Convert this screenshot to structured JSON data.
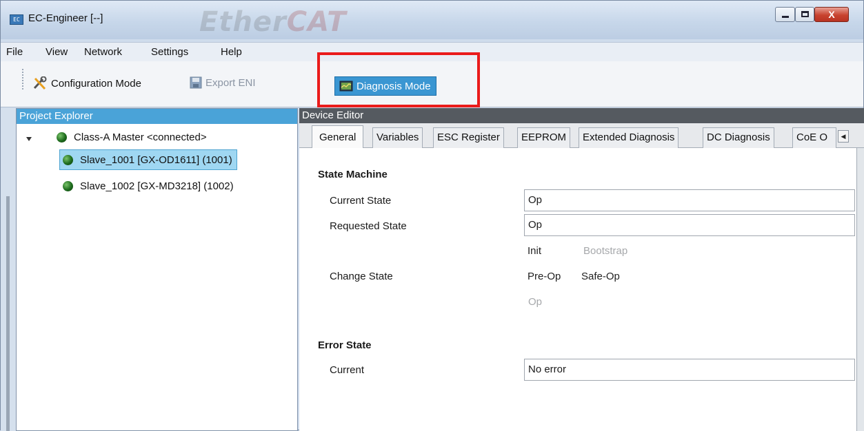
{
  "window": {
    "title": "EC-Engineer [--]",
    "app_icon_text": "EC",
    "brand_logo_prefix": "Ether",
    "brand_logo_suffix": "CAT"
  },
  "window_controls": {
    "minimize": "minimize",
    "maximize": "maximize",
    "close": "X"
  },
  "menu": [
    "File",
    "View",
    "Network",
    "Settings",
    "Help"
  ],
  "toolbar": {
    "configuration_mode": "Configuration Mode",
    "export_eni": "Export ENI",
    "diagnosis_mode": "Diagnosis Mode"
  },
  "project_explorer": {
    "title": "Project Explorer",
    "master": "Class-A Master <connected>",
    "slaves": [
      {
        "label": "Slave_1001 [GX-OD1611] (1001)",
        "selected": true
      },
      {
        "label": "Slave_1002 [GX-MD3218] (1002)",
        "selected": false
      }
    ]
  },
  "device_editor": {
    "title": "Device Editor",
    "tabs": [
      "General",
      "Variables",
      "ESC Register",
      "EEPROM",
      "Extended Diagnosis",
      "DC Diagnosis",
      "CoE O"
    ],
    "active_tab": "General",
    "state_machine": {
      "title": "State Machine",
      "current_state_label": "Current State",
      "current_state_value": "Op",
      "requested_state_label": "Requested State",
      "requested_state_value": "Op",
      "change_state_label": "Change State",
      "states": {
        "init": "Init",
        "bootstrap": "Bootstrap",
        "pre_op": "Pre-Op",
        "safe_op": "Safe-Op",
        "op": "Op"
      }
    },
    "error_state": {
      "title": "Error State",
      "current_label": "Current",
      "current_value": "No error"
    }
  },
  "colors": {
    "accent": "#3a96d2",
    "selection": "#9fd7f2",
    "highlight": "#ea1b1b",
    "status_ok": "#1d6b1d"
  }
}
